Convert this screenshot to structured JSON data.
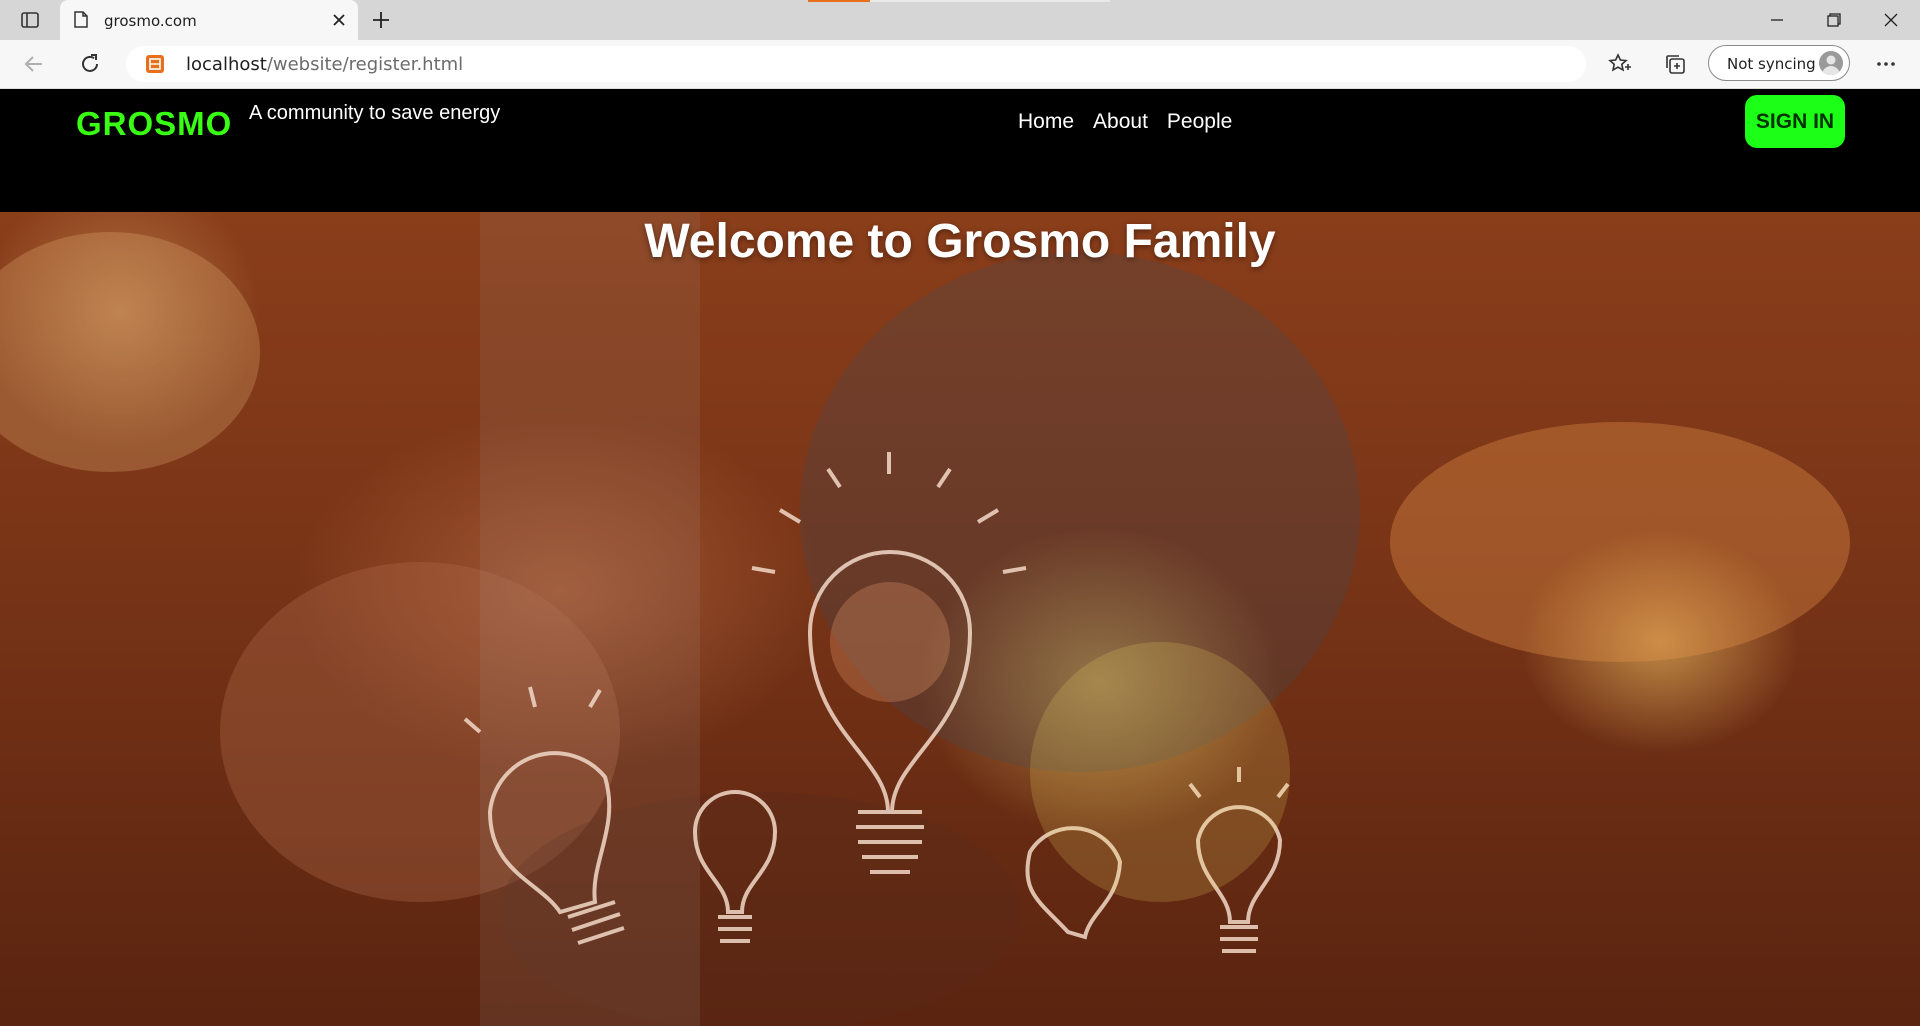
{
  "browser": {
    "tab_title": "grosmo.com",
    "url_host": "localhost",
    "url_path": "/website/register.html",
    "sync_label": "Not syncing"
  },
  "site": {
    "brand": "GROSMO",
    "tagline": "A community to save energy",
    "nav": [
      "Home",
      "About",
      "People"
    ],
    "signin_label": "SIGN IN",
    "hero_title": "Welcome to Grosmo Family"
  },
  "colors": {
    "brand_green": "#39ff14",
    "button_green": "#1cff16",
    "header_bg": "#000000",
    "hero_tone": "#7a3517"
  },
  "icons": [
    "tab-actions-icon",
    "page-icon",
    "close-icon",
    "plus-icon",
    "minimize-icon",
    "restore-icon",
    "back-icon",
    "refresh-icon",
    "site-icon",
    "favorites-icon",
    "collections-icon",
    "avatar-icon",
    "more-icon",
    "lightbulb-icon"
  ]
}
